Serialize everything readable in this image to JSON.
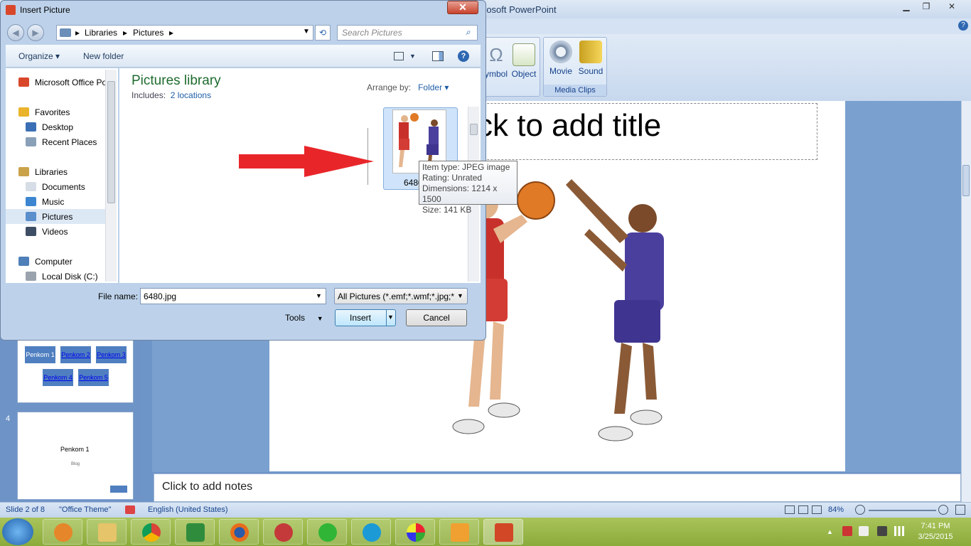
{
  "powerpoint": {
    "title": "Microsoft PowerPoint",
    "title_visible": "rosoft PowerPoint",
    "ribbon": {
      "symbol_label": "ymbol",
      "object_label": "Object",
      "movie_label": "Movie",
      "sound_label": "Sound",
      "media_group": "Media Clips"
    },
    "slide": {
      "title_placeholder": "ck to add title"
    },
    "notes_placeholder": "Click to add notes",
    "thumbnails": {
      "slide3_buttons": [
        "Penkom 1",
        "Penkom 2",
        "Penkom 3",
        "Penkom 4",
        "Penkom 5"
      ],
      "slide4_number": "4",
      "slide4_title": "Penkom 1",
      "slide4_sub": "Blog"
    },
    "status": {
      "slide": "Slide 2 of 8",
      "theme": "\"Office Theme\"",
      "language": "English (United States)",
      "zoom": "84%"
    }
  },
  "taskbar": {
    "time": "7:41 PM",
    "date": "3/25/2015"
  },
  "dialog": {
    "title": "Insert Picture",
    "close": "✕",
    "breadcrumb": [
      "Libraries",
      "Pictures"
    ],
    "search_placeholder": "Search Pictures",
    "toolbar": {
      "organize": "Organize ▾",
      "new_folder": "New folder"
    },
    "nav": [
      {
        "label": "Microsoft Office Po",
        "color": "#d9472b"
      },
      {
        "label": "Favorites",
        "color": "#e9b32b"
      },
      {
        "label": "Desktop",
        "color": "#3a6fb5"
      },
      {
        "label": "Recent Places",
        "color": "#8aa0b8"
      },
      {
        "label": "Libraries",
        "color": "#c9a24a"
      },
      {
        "label": "Documents",
        "color": "#d7dde6"
      },
      {
        "label": "Music",
        "color": "#3c86d1"
      },
      {
        "label": "Pictures",
        "color": "#5a8fcb"
      },
      {
        "label": "Videos",
        "color": "#3d4d63"
      },
      {
        "label": "Computer",
        "color": "#4f7fb8"
      },
      {
        "label": "Local Disk (C:)",
        "color": "#9aa3ad"
      }
    ],
    "library_title": "Pictures library",
    "includes_label": "Includes:",
    "includes_link": "2 locations",
    "arrange_label": "Arrange by:",
    "arrange_value": "Folder ▾",
    "file": {
      "name": "6480"
    },
    "tooltip": [
      "Item type: JPEG image",
      "Rating: Unrated",
      "Dimensions: 1214 x 1500",
      "Size: 141 KB"
    ],
    "file_name_label": "File name:",
    "file_name_value": "6480.jpg",
    "filter": "All Pictures (*.emf;*.wmf;*.jpg;*",
    "tools": "Tools",
    "insert": "Insert",
    "cancel": "Cancel"
  }
}
